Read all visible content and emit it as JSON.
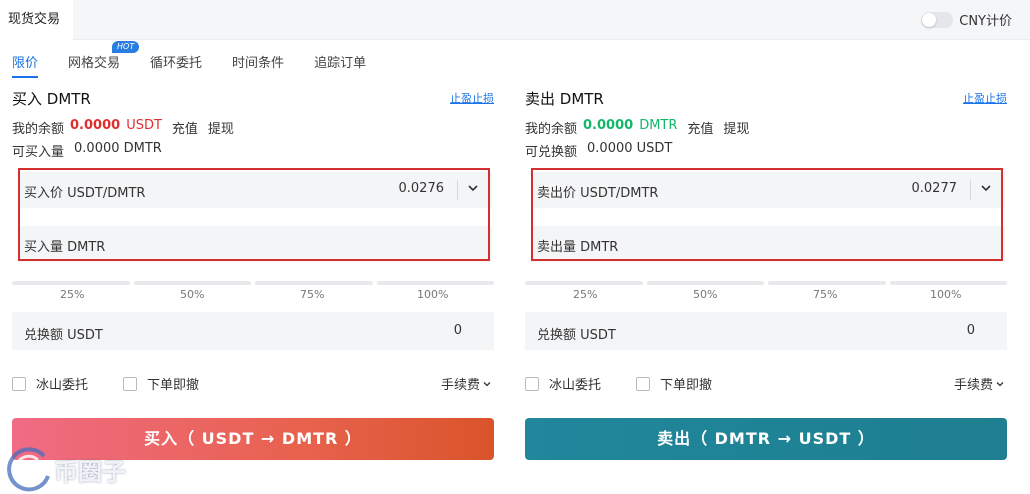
{
  "header": {
    "active_tab": "现货交易",
    "cny_label": "CNY计价"
  },
  "modes": {
    "items": [
      "限价",
      "网格交易",
      "循环委托",
      "时间条件",
      "追踪订单"
    ],
    "hot_badge": "HOT"
  },
  "buy": {
    "title": "买入 DMTR",
    "tp_sl": "止盈止损",
    "balance_label": "我的余额",
    "balance_value": "0.0000",
    "balance_currency": "USDT",
    "deposit": "充值",
    "withdraw": "提现",
    "avail_label": "可买入量",
    "avail_value": "0.0000 DMTR",
    "price_label": "买入价 USDT/DMTR",
    "price_value": "0.0276",
    "amount_label": "买入量 DMTR",
    "total_label": "兑换额 USDT",
    "total_value": "0",
    "button": "买入（ USDT → DMTR ）"
  },
  "sell": {
    "title": "卖出 DMTR",
    "tp_sl": "止盈止损",
    "balance_label": "我的余额",
    "balance_value": "0.0000",
    "balance_currency": "DMTR",
    "deposit": "充值",
    "withdraw": "提现",
    "avail_label": "可兑换额",
    "avail_value": "0.0000 USDT",
    "price_label": "卖出价 USDT/DMTR",
    "price_value": "0.0277",
    "amount_label": "卖出量 DMTR",
    "total_label": "兑换额 USDT",
    "total_value": "0",
    "button": "卖出（ DMTR → USDT ）"
  },
  "percents": [
    "25%",
    "50%",
    "75%",
    "100%"
  ],
  "options": {
    "iceberg": "冰山委托",
    "ioc": "下单即撤",
    "fee": "手续费"
  },
  "watermark": "币圈子",
  "colors": {
    "accent": "#1a73e8",
    "buy_red": "#e02e2e",
    "sell_green": "#12b76a",
    "buy_button": "#e8624e",
    "sell_button": "#1e7f90"
  }
}
